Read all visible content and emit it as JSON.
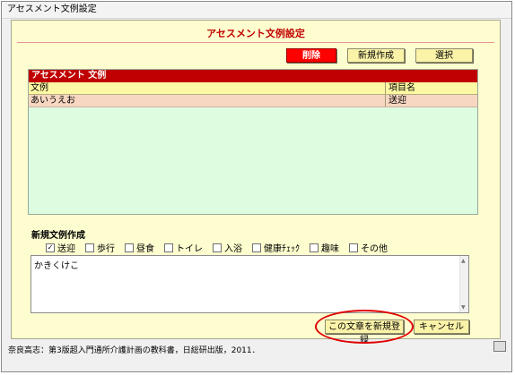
{
  "window": {
    "title": "アセスメント文例設定"
  },
  "form": {
    "title": "アセスメント文例設定",
    "buttons": {
      "delete": "削除",
      "new": "新規作成",
      "select": "選択"
    }
  },
  "grid": {
    "title": "アセスメント 文例",
    "headers": [
      "文例",
      "項目名"
    ],
    "rows": [
      {
        "text": "あいうえお",
        "item": "送迎"
      }
    ]
  },
  "new_section": {
    "label": "新規文例作成",
    "checkboxes": [
      {
        "label": "送迎",
        "checked": true
      },
      {
        "label": "歩行",
        "checked": false
      },
      {
        "label": "昼食",
        "checked": false
      },
      {
        "label": "トイレ",
        "checked": false
      },
      {
        "label": "入浴",
        "checked": false
      },
      {
        "label": "健康ﾁｪｯｸ",
        "checked": false
      },
      {
        "label": "趣味",
        "checked": false
      },
      {
        "label": "その他",
        "checked": false
      }
    ],
    "text_value": "かきくけこ",
    "register_label": "この文章を新規登録",
    "cancel_label": "キャンセル"
  },
  "footer": {
    "caption": "奈良高志：第3版超入門通所介護計画の教科書，日総研出版，2011．"
  },
  "colors": {
    "accent_red": "#c00000",
    "panel_bg": "#fefdcf",
    "grid_bg": "#dcfde0"
  }
}
